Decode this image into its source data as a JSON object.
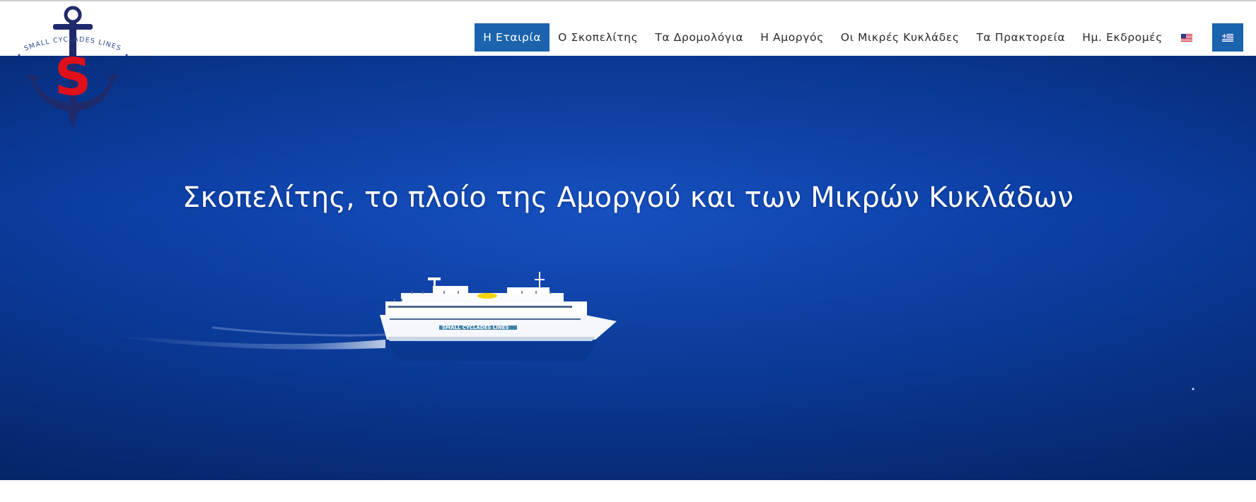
{
  "brand": {
    "logo_text": "SMALL CYCLADES LINES",
    "logo_letter": "S",
    "colors": {
      "navy": "#1f2a6b",
      "red": "#e0101a"
    }
  },
  "nav": {
    "items": [
      {
        "label": "Η Εταιρία",
        "active": true
      },
      {
        "label": "Ο Σκοπελίτης",
        "active": false
      },
      {
        "label": "Τα Δρομολόγια",
        "active": false
      },
      {
        "label": "Η Αμοργός",
        "active": false
      },
      {
        "label": "Οι Μικρές Κυκλάδες",
        "active": false
      },
      {
        "label": "Τα Πρακτορεία",
        "active": false
      },
      {
        "label": "Ημ. Εκδρομές",
        "active": false
      }
    ],
    "languages": [
      {
        "icon": "us-flag-icon"
      },
      {
        "icon": "greek-flag-icon"
      }
    ],
    "accent_color": "#1b63ad"
  },
  "hero": {
    "title": "Σκοπελίτης, το πλοίο της Αμοργού και των Μικρών Κυκλάδων",
    "ship_text": "SMALL CYCLADES LINES",
    "sea_color": "#0a3fa0"
  }
}
